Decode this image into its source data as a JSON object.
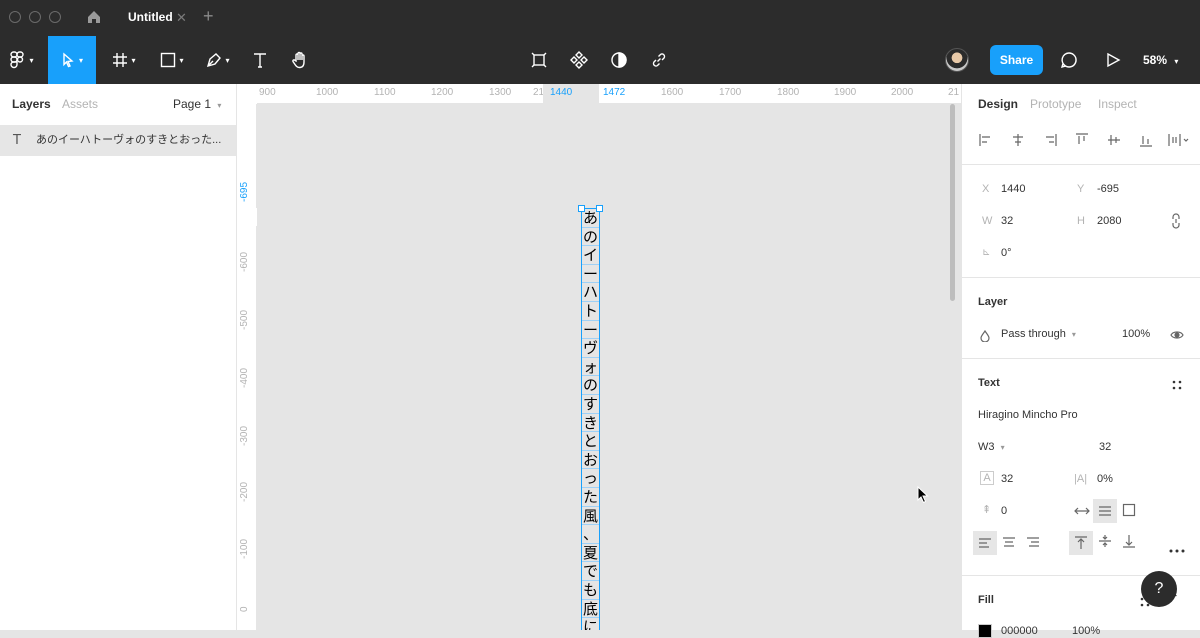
{
  "titlebar": {
    "tab_title": "Untitled"
  },
  "toolbar": {
    "share_label": "Share",
    "zoom_label": "58%"
  },
  "left_panel": {
    "tabs": [
      "Layers",
      "Assets"
    ],
    "page_selector": "Page 1",
    "layers": [
      {
        "name": "あのイーハトーヴォのすきとおった..."
      }
    ]
  },
  "ruler": {
    "h_labels": [
      "900",
      "1000",
      "1100",
      "1200",
      "1300",
      "21",
      "1440",
      "1472",
      "1600",
      "1700",
      "1800",
      "1900",
      "2000",
      "21"
    ],
    "v_labels": [
      "-695",
      "-600",
      "-500",
      "-400",
      "-300",
      "-200",
      "-100",
      "0"
    ]
  },
  "canvas": {
    "vertical_text": [
      "あ",
      "の",
      "イ",
      "ー",
      "ハ",
      "ト",
      "ー",
      "ヴ",
      "ォ",
      "の",
      "す",
      "き",
      "と",
      "お",
      "っ",
      "た",
      "風",
      "、",
      "夏",
      "で",
      "も",
      "底",
      "に"
    ]
  },
  "right_panel": {
    "tabs": [
      "Design",
      "Prototype",
      "Inspect"
    ],
    "position": {
      "x_label": "X",
      "x_value": "1440",
      "y_label": "Y",
      "y_value": "-695"
    },
    "size": {
      "w_label": "W",
      "w_value": "32",
      "h_label": "H",
      "h_value": "2080"
    },
    "rotation": "0°",
    "layer": {
      "title": "Layer",
      "blend": "Pass through",
      "opacity": "100%"
    },
    "text": {
      "title": "Text",
      "font_family": "Hiragino Mincho Pro",
      "font_weight": "W3",
      "font_size": "32",
      "line_height": "32",
      "letter_spacing": "0%",
      "paragraph_spacing": "0"
    },
    "fill": {
      "title": "Fill",
      "hex": "000000",
      "opacity": "100%"
    }
  },
  "help_label": "?",
  "colors": {
    "accent": "#18a0fb",
    "toolbar": "#2c2c2c"
  }
}
